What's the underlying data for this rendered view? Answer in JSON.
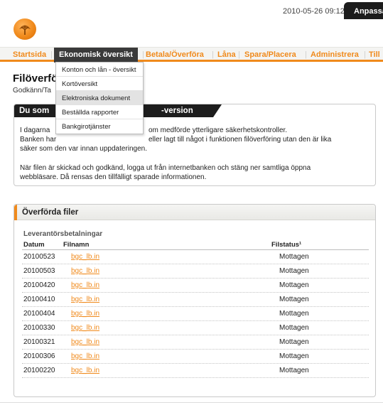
{
  "header": {
    "datetime": "2010-05-26 09:12",
    "customize_label": "Anpassa"
  },
  "nav": {
    "items": [
      "Startsida",
      "Ekonomisk översikt",
      "Betala/Överföra",
      "Låna",
      "Spara/Placera",
      "Administrera",
      "Till"
    ],
    "active_index": 1,
    "accent_color": "#f08a1c"
  },
  "dropdown": {
    "items": [
      "Konton och lån - översikt",
      "Kortöversikt",
      "Elektroniska dokument",
      "Beställda rapporter",
      "Bankgirotjänster"
    ],
    "hover_index": 2
  },
  "page": {
    "title": "Filöverfö",
    "subtitle": "Godkänn/Ta"
  },
  "notice": {
    "title_left": "Du som",
    "title_right": "-version",
    "p1_line1_left": "I dagarna",
    "p1_line1_right": "om medförde ytterligare säkerhetskontroller.",
    "p1_line2_left": "Banken har",
    "p1_line2_right": "eller lagt till något i funktionen filöverföring utan den är lika",
    "p1_line3": "säker som den var innan uppdateringen.",
    "p2_line1": "När filen är skickad och godkänd, logga ut från internetbanken och stäng ner samtliga öppna",
    "p2_line2": "webbläsare. Då rensas den tillfälligt sparade informationen."
  },
  "files": {
    "title": "Överförda filer",
    "group_label": "Leverantörsbetalningar",
    "columns": {
      "date": "Datum",
      "name": "Filnamn",
      "status": "Filstatus¹"
    },
    "rows": [
      {
        "date": "20100523",
        "name": "bgc_lb.in",
        "status": "Mottagen"
      },
      {
        "date": "20100503",
        "name": "bgc_lb.in",
        "status": "Mottagen"
      },
      {
        "date": "20100420",
        "name": "bgc_lb.in",
        "status": "Mottagen"
      },
      {
        "date": "20100410",
        "name": "bgc_lb.in",
        "status": "Mottagen"
      },
      {
        "date": "20100404",
        "name": "bgc_lb.in",
        "status": "Mottagen"
      },
      {
        "date": "20100330",
        "name": "bgc_lb.in",
        "status": "Mottagen"
      },
      {
        "date": "20100321",
        "name": "bgc_lb.in",
        "status": "Mottagen"
      },
      {
        "date": "20100306",
        "name": "bgc_lb.in",
        "status": "Mottagen"
      },
      {
        "date": "20100220",
        "name": "bgc_lb.in",
        "status": "Mottagen"
      }
    ]
  }
}
